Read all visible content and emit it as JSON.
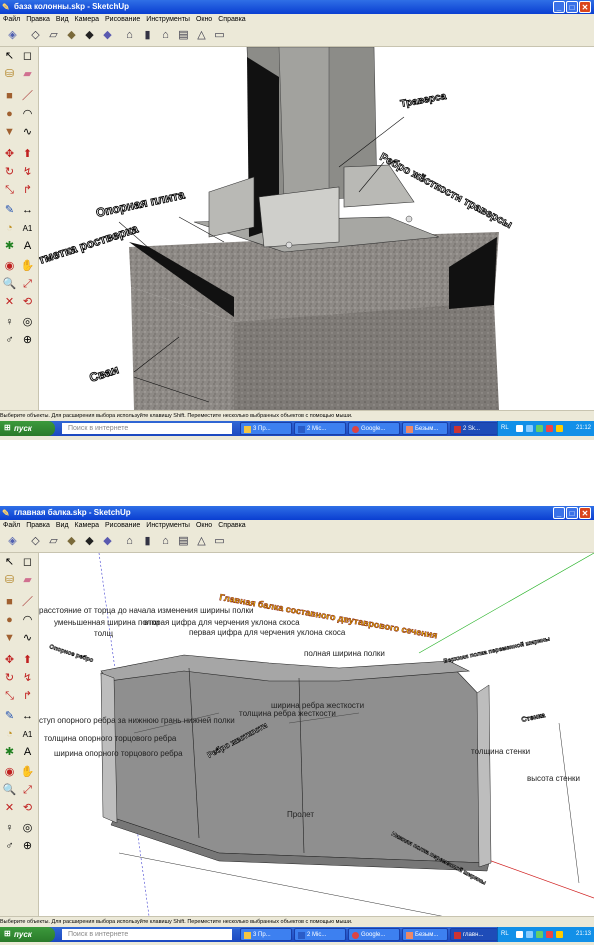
{
  "windows": [
    {
      "title": "база колонны.skp - SketchUp",
      "menu": [
        "Файл",
        "Правка",
        "Вид",
        "Камера",
        "Рисование",
        "Инструменты",
        "Окно",
        "Справка"
      ],
      "status": "Выберите объекты. Для расширения выбора используйте клавишу Shift. Переместите несколько выбранных объектов с помощью мыши.",
      "labels": {
        "a": "Опорная плита",
        "b": "Траверса",
        "c": "Ребро жёсткости траверсы",
        "d": "Отметка ростверка",
        "e": "Сваи"
      },
      "taskbar": {
        "start": "пуск",
        "search_placeholder": "Поиск в интернете",
        "tasks": [
          "3 Пр...",
          "2 Mic...",
          "Google...",
          "Безым...",
          "2 Sk..."
        ],
        "lang": "RL",
        "clock": "21:12"
      }
    },
    {
      "title": "главная балка.skp - SketchUp",
      "menu": [
        "Файл",
        "Правка",
        "Вид",
        "Камера",
        "Рисование",
        "Инструменты",
        "Окно",
        "Справка"
      ],
      "status": "Выберите объекты. Для расширения выбора используйте клавишу Shift. Переместите несколько выбранных объектов с помощью мыши.",
      "labels": {
        "title": "Главная балка составного двутаврового сечения",
        "l1": "расстояние от торца до начала изменения ширины полки",
        "l2": "уменьшенная ширина полки",
        "l3": "вторая цифра для черчения уклона скоса",
        "l4": "толщ",
        "l5": "первая цифра для черчения уклона скоса",
        "l6": "полная ширина полки",
        "l7": "Опорное ребро",
        "l8": "Верхняя полка переменной ширины",
        "l9": "ширина ребра жесткости",
        "l10": "толщина ребра жесткости",
        "l11": "выступ опорного ребра за нижнюю грань нижней полки",
        "l12": "толщина опорного торцового ребра",
        "l13": "ширина опорного торцового ребра",
        "l14": "Ребро жесткости",
        "l15": "Стенка",
        "l16": "толщина стенки",
        "l17": "высота стенки",
        "l18": "Пролет",
        "l19": "Нижняя полка переменной ширины"
      },
      "taskbar": {
        "start": "пуск",
        "search_placeholder": "Поиск в интернете",
        "tasks": [
          "3 Пр...",
          "2 Mic...",
          "Google...",
          "Безым...",
          "главн..."
        ],
        "lang": "RL",
        "clock": "21:13"
      }
    }
  ]
}
